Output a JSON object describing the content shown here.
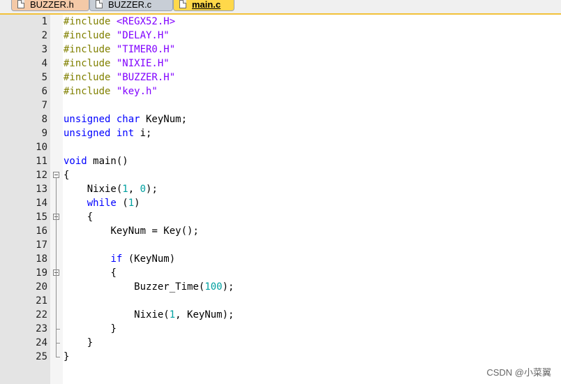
{
  "tabs": [
    {
      "label": "BUZZER.h",
      "active": false
    },
    {
      "label": "BUZZER.c",
      "active": false
    },
    {
      "label": "main.c",
      "active": true
    }
  ],
  "editor": {
    "line_numbers": [
      "1",
      "2",
      "3",
      "4",
      "5",
      "6",
      "7",
      "8",
      "9",
      "10",
      "11",
      "12",
      "13",
      "14",
      "15",
      "16",
      "17",
      "18",
      "19",
      "20",
      "21",
      "22",
      "23",
      "24",
      "25"
    ],
    "lines": [
      {
        "indent": "",
        "segments": [
          {
            "t": "#include ",
            "c": "pp"
          },
          {
            "t": "<REGX52.H>",
            "c": "str"
          }
        ]
      },
      {
        "indent": "",
        "segments": [
          {
            "t": "#include ",
            "c": "pp"
          },
          {
            "t": "\"DELAY.H\"",
            "c": "str"
          }
        ]
      },
      {
        "indent": "",
        "segments": [
          {
            "t": "#include ",
            "c": "pp"
          },
          {
            "t": "\"TIMER0.H\"",
            "c": "str"
          }
        ]
      },
      {
        "indent": "",
        "segments": [
          {
            "t": "#include ",
            "c": "pp"
          },
          {
            "t": "\"NIXIE.H\"",
            "c": "str"
          }
        ]
      },
      {
        "indent": "",
        "segments": [
          {
            "t": "#include ",
            "c": "pp"
          },
          {
            "t": "\"BUZZER.H\"",
            "c": "str"
          }
        ]
      },
      {
        "indent": "",
        "segments": [
          {
            "t": "#include ",
            "c": "pp"
          },
          {
            "t": "\"key.h\"",
            "c": "str"
          }
        ]
      },
      {
        "indent": "",
        "segments": []
      },
      {
        "indent": "",
        "segments": [
          {
            "t": "unsigned char",
            "c": "kw"
          },
          {
            "t": " KeyNum;",
            "c": ""
          }
        ]
      },
      {
        "indent": "",
        "segments": [
          {
            "t": "unsigned int",
            "c": "kw"
          },
          {
            "t": " i;",
            "c": ""
          }
        ]
      },
      {
        "indent": "",
        "segments": []
      },
      {
        "indent": "",
        "segments": [
          {
            "t": "void",
            "c": "kw"
          },
          {
            "t": " main()",
            "c": ""
          }
        ]
      },
      {
        "indent": "",
        "segments": [
          {
            "t": "{",
            "c": ""
          }
        ]
      },
      {
        "indent": "    ",
        "segments": [
          {
            "t": "Nixie(",
            "c": ""
          },
          {
            "t": "1",
            "c": "num"
          },
          {
            "t": ", ",
            "c": ""
          },
          {
            "t": "0",
            "c": "num"
          },
          {
            "t": ");",
            "c": ""
          }
        ]
      },
      {
        "indent": "    ",
        "segments": [
          {
            "t": "while",
            "c": "kw"
          },
          {
            "t": " (",
            "c": ""
          },
          {
            "t": "1",
            "c": "num"
          },
          {
            "t": ")",
            "c": ""
          }
        ]
      },
      {
        "indent": "    ",
        "segments": [
          {
            "t": "{",
            "c": ""
          }
        ]
      },
      {
        "indent": "        ",
        "segments": [
          {
            "t": "KeyNum = Key();",
            "c": ""
          }
        ]
      },
      {
        "indent": "",
        "segments": []
      },
      {
        "indent": "        ",
        "segments": [
          {
            "t": "if",
            "c": "kw"
          },
          {
            "t": " (KeyNum)",
            "c": ""
          }
        ]
      },
      {
        "indent": "        ",
        "segments": [
          {
            "t": "{",
            "c": ""
          }
        ]
      },
      {
        "indent": "            ",
        "segments": [
          {
            "t": "Buzzer_Time(",
            "c": ""
          },
          {
            "t": "100",
            "c": "num"
          },
          {
            "t": ");",
            "c": ""
          }
        ]
      },
      {
        "indent": "",
        "segments": []
      },
      {
        "indent": "            ",
        "segments": [
          {
            "t": "Nixie(",
            "c": ""
          },
          {
            "t": "1",
            "c": "num"
          },
          {
            "t": ", KeyNum);",
            "c": ""
          }
        ]
      },
      {
        "indent": "        ",
        "segments": [
          {
            "t": "}",
            "c": ""
          }
        ]
      },
      {
        "indent": "    ",
        "segments": [
          {
            "t": "}",
            "c": ""
          }
        ]
      },
      {
        "indent": "",
        "segments": [
          {
            "t": "}",
            "c": ""
          }
        ]
      }
    ],
    "fold_markers": [
      "12",
      "15",
      "19"
    ]
  },
  "colors": {
    "preprocessor": "#808000",
    "string": "#8000ff",
    "keyword": "#0000ff",
    "number": "#00a0a0"
  },
  "watermark": "CSDN @小菜翼"
}
